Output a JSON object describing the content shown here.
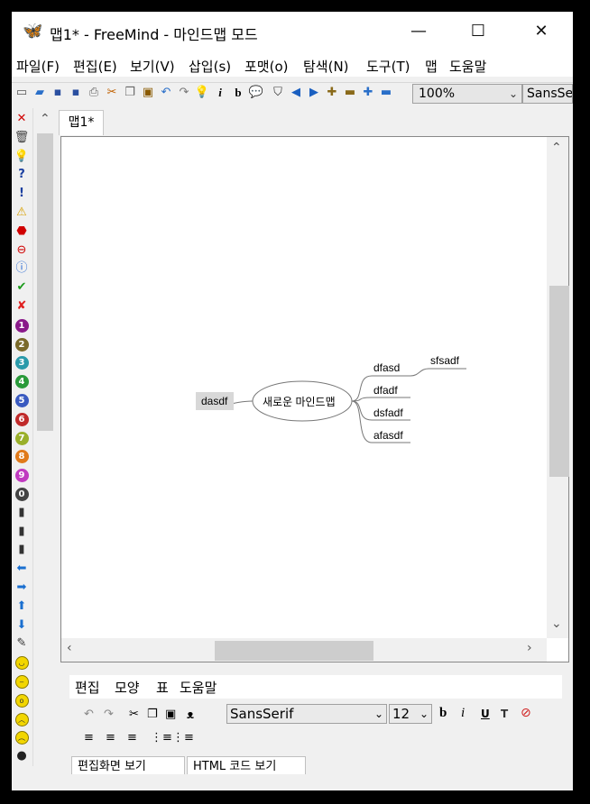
{
  "window": {
    "title": "맵1* - FreeMind - 마인드맵 모드",
    "minimize_glyph": "—",
    "maximize_glyph": "☐",
    "close_glyph": "✕"
  },
  "menu": [
    "파일(F)",
    "편집(E)",
    "보기(V)",
    "삽입(s)",
    "포맷(o)",
    "탐색(N)",
    "도구(T)",
    "맵",
    "도움말"
  ],
  "toolbar": {
    "zoom_value": "100%",
    "font_value": "SansSerif"
  },
  "tab": {
    "label": "맵1*"
  },
  "mindmap": {
    "root": "새로운 마인드맵",
    "left_child": "dasdf",
    "right_children": [
      "dfasd",
      "dfadf",
      "dsfadf",
      "afasdf"
    ],
    "grandchild": "sfsadf",
    "colors": {
      "edge": "#777777",
      "left_node_bg": "#d8d8d8"
    }
  },
  "editor": {
    "menu": [
      "편집",
      "모양",
      "표",
      "도움말"
    ],
    "font_value": "SansSerif",
    "size_value": "12",
    "bottom_tabs": [
      "편집화면 보기",
      "HTML 코드 보기"
    ]
  },
  "icons": {
    "left_toolbar": [
      "close-icon",
      "trash-icon",
      "idea-icon",
      "question-icon",
      "exclamation-icon",
      "warning-icon",
      "stop-icon",
      "no-entry-icon",
      "info-icon",
      "check-icon",
      "cross-icon",
      "priority-1-icon",
      "priority-2-icon",
      "priority-3-icon",
      "priority-4-icon",
      "priority-5-icon",
      "priority-6-icon",
      "priority-7-icon",
      "priority-8-icon",
      "priority-9-icon",
      "priority-0-icon",
      "traffic-light-red-icon",
      "traffic-light-yellow-icon",
      "traffic-light-green-icon",
      "arrow-left-icon",
      "arrow-right-icon",
      "arrow-up-icon",
      "arrow-down-icon",
      "pencil-icon",
      "smiley-happy-icon",
      "smiley-neutral-icon",
      "smiley-amazed-icon",
      "smiley-angry-icon",
      "smiley-sad-icon",
      "bomb-icon"
    ]
  }
}
